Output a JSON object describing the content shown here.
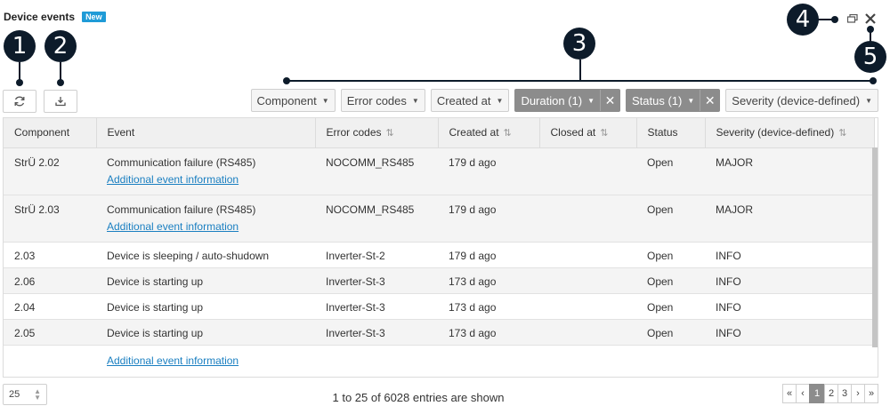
{
  "header": {
    "title": "Device events",
    "badge": "New"
  },
  "callouts": [
    "1",
    "2",
    "3",
    "4",
    "5"
  ],
  "toolbar": {
    "refresh_icon": "refresh-icon",
    "download_icon": "download-icon"
  },
  "filters": [
    {
      "label": "Component",
      "active": false
    },
    {
      "label": "Error codes",
      "active": false
    },
    {
      "label": "Created at",
      "active": false
    },
    {
      "label": "Duration (1)",
      "active": true
    },
    {
      "label": "Status (1)",
      "active": true
    },
    {
      "label": "Severity (device-defined)",
      "active": false
    }
  ],
  "columns": [
    "Component",
    "Event",
    "Error codes",
    "Created at",
    "Closed at",
    "Status",
    "Severity (device-defined)"
  ],
  "rows": [
    {
      "component": "StrÜ 2.02",
      "event": "Communication failure (RS485)",
      "link": "Additional event information",
      "error": "NOCOMM_RS485",
      "created": "179 d ago",
      "closed": "",
      "status": "Open",
      "severity": "MAJOR"
    },
    {
      "component": "StrÜ 2.03",
      "event": "Communication failure (RS485)",
      "link": "Additional event information",
      "error": "NOCOMM_RS485",
      "created": "179 d ago",
      "closed": "",
      "status": "Open",
      "severity": "MAJOR"
    },
    {
      "component": "2.03",
      "event": "Device is sleeping / auto-shudown",
      "link": "",
      "error": "Inverter-St-2",
      "created": "179 d ago",
      "closed": "",
      "status": "Open",
      "severity": "INFO"
    },
    {
      "component": "2.06",
      "event": "Device is starting up",
      "link": "",
      "error": "Inverter-St-3",
      "created": "173 d ago",
      "closed": "",
      "status": "Open",
      "severity": "INFO"
    },
    {
      "component": "2.04",
      "event": "Device is starting up",
      "link": "",
      "error": "Inverter-St-3",
      "created": "173 d ago",
      "closed": "",
      "status": "Open",
      "severity": "INFO"
    },
    {
      "component": "2.05",
      "event": "Device is starting up",
      "link": "",
      "error": "Inverter-St-3",
      "created": "173 d ago",
      "closed": "",
      "status": "Open",
      "severity": "INFO"
    }
  ],
  "tail_link": "Additional event information",
  "footer": {
    "page_size": "25",
    "entries_text": "1 to 25 of 6028 entries are shown",
    "pager": [
      "«",
      "‹",
      "1",
      "2",
      "3",
      "›",
      "»"
    ],
    "current_page": "1"
  }
}
